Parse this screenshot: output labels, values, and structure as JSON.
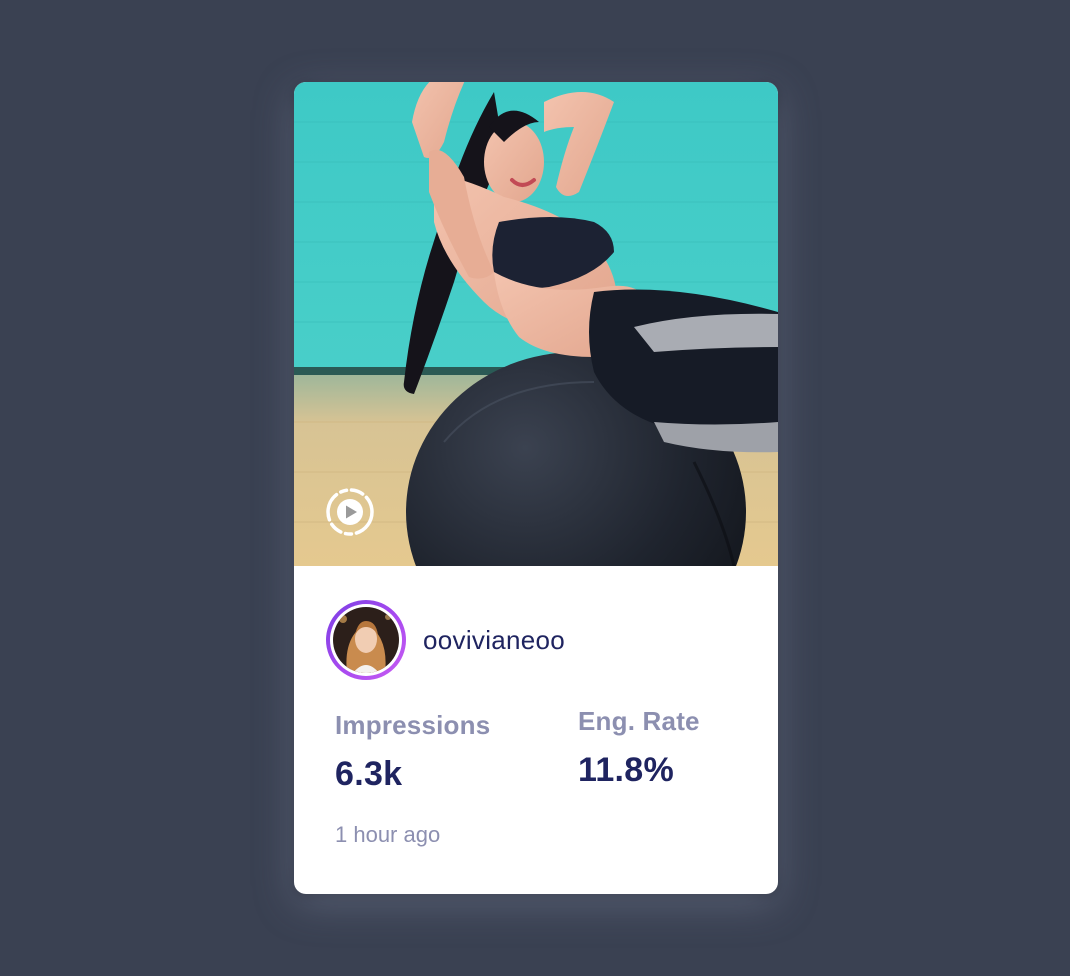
{
  "post": {
    "media": {
      "type": "video",
      "description_icon": "play-circle-icon"
    },
    "user": {
      "username": "oovivianeoo"
    },
    "stats": {
      "impressions_label": "Impressions",
      "impressions_value": "6.3k",
      "eng_rate_label": "Eng. Rate",
      "eng_rate_value": "11.8%"
    },
    "timestamp": "1 hour ago"
  },
  "colors": {
    "page_background": "#3a4152",
    "card_background": "#ffffff",
    "primary_text": "#1f2460",
    "secondary_text": "#8c8fb0",
    "avatar_ring_start": "#7b3fe4",
    "avatar_ring_end": "#c85cf2"
  }
}
